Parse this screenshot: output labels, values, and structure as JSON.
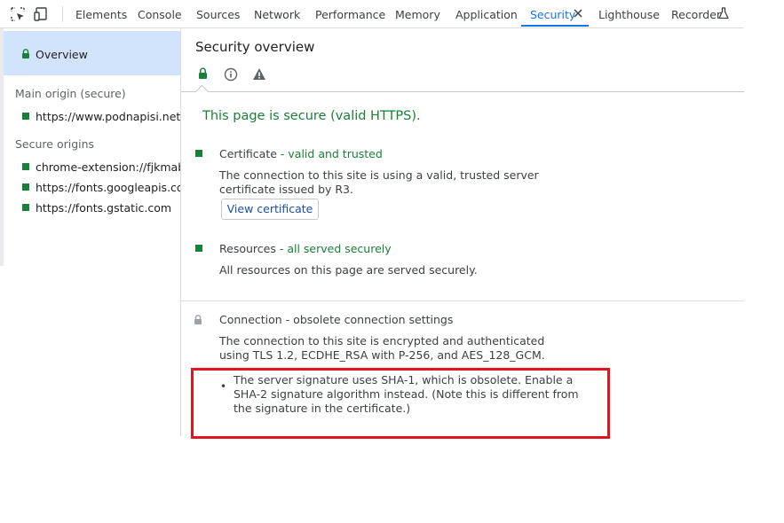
{
  "toolbar": {
    "tabs": [
      {
        "label": "Elements"
      },
      {
        "label": "Console"
      },
      {
        "label": "Sources"
      },
      {
        "label": "Network"
      },
      {
        "label": "Performance"
      },
      {
        "label": "Memory"
      },
      {
        "label": "Application"
      },
      {
        "label": "Security",
        "active": true
      },
      {
        "label": "Lighthouse"
      },
      {
        "label": "Recorder"
      }
    ],
    "icons": [
      "inspect-element-icon",
      "device-toolbar-icon",
      "close-icon",
      "flask-icon"
    ]
  },
  "sidebar": {
    "overview_label": "Overview",
    "main_origin_heading": "Main origin (secure)",
    "main_origin": "https://www.podnapisi.net",
    "secure_origins_heading": "Secure origins",
    "secure_origins": [
      "chrome-extension://fjkmabmdepjfammlpliljpnbhleegehm",
      "https://fonts.googleapis.com",
      "https://fonts.gstatic.com"
    ]
  },
  "main": {
    "title": "Security overview",
    "summary": "This page is secure (valid HTTPS).",
    "certificate": {
      "title": "Certificate",
      "separator": " - ",
      "status": "valid and trusted",
      "description": "The connection to this site is using a valid, trusted server certificate issued by R3.",
      "button": "View certificate"
    },
    "resources": {
      "title": "Resources",
      "separator": " - ",
      "status": "all served securely",
      "description": "All resources on this page are served securely."
    },
    "connection": {
      "title": "Connection - obsolete connection settings",
      "description": "The connection to this site is encrypted and authenticated using TLS 1.2, ECDHE_RSA with P-256, and AES_128_GCM.",
      "bullet": "•",
      "issue": "The server signature uses SHA-1, which is obsolete. Enable a SHA-2 signature algorithm instead. (Note this is different from the signature in the certificate.)"
    }
  },
  "colors": {
    "secure_green": "#188038",
    "accent_blue": "#1a73e8",
    "overview_selected": "#d2e3fc",
    "highlight_red": "#e0151e"
  }
}
